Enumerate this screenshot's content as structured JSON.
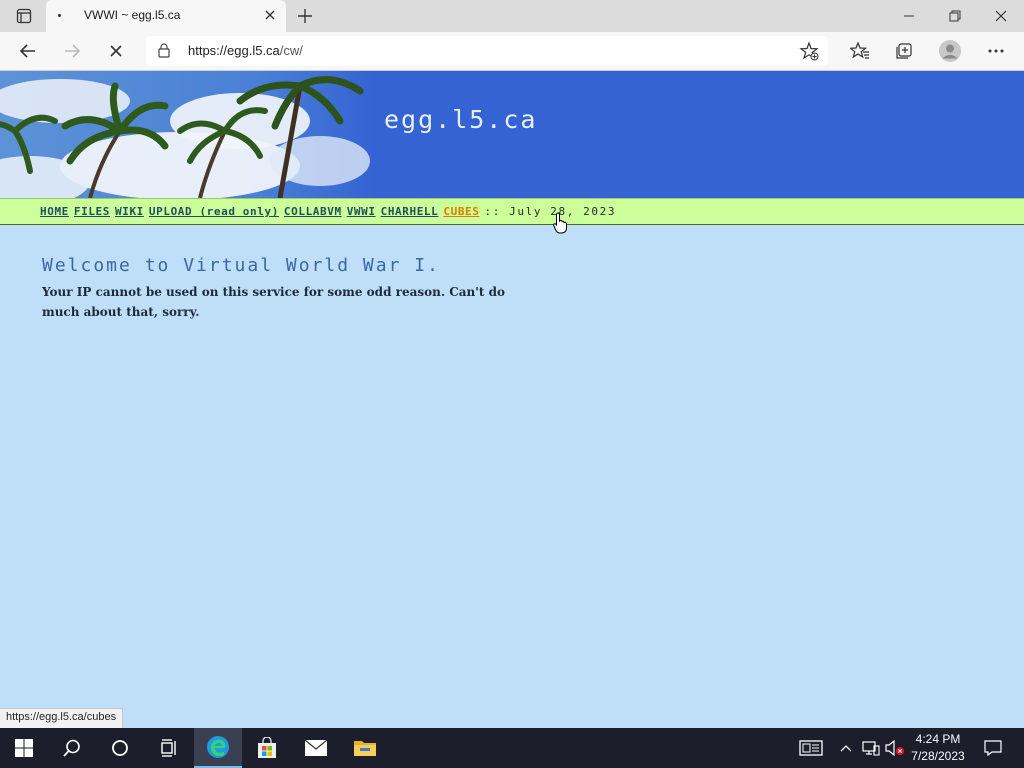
{
  "browser": {
    "tab_title": "VWWI ~ egg.l5.ca",
    "url_host": "https://egg.l5.ca",
    "url_path": "/cw/"
  },
  "page": {
    "site_title": "egg.l5.ca",
    "nav": [
      {
        "label": "HOME"
      },
      {
        "label": "FILES"
      },
      {
        "label": "WIKI"
      },
      {
        "label": "UPLOAD (read only)"
      },
      {
        "label": "COLLABVM"
      },
      {
        "label": "VWWI"
      },
      {
        "label": "CHARHELL"
      },
      {
        "label": "CUBES"
      }
    ],
    "date_text": ":: July 28, 2023",
    "heading": "Welcome to Virtual World War I.",
    "message": "Your IP cannot be used on this service for some odd reason. Can't do much about that, sorry."
  },
  "status_bar": {
    "link_url": "https://egg.l5.ca/cubes"
  },
  "taskbar": {
    "time": "4:24 PM",
    "date": "7/28/2023"
  },
  "colors": {
    "banner_blue": "#3563d3",
    "nav_green": "#ccff99",
    "page_bg": "#bfdff8",
    "hover_link": "#e07a00"
  }
}
